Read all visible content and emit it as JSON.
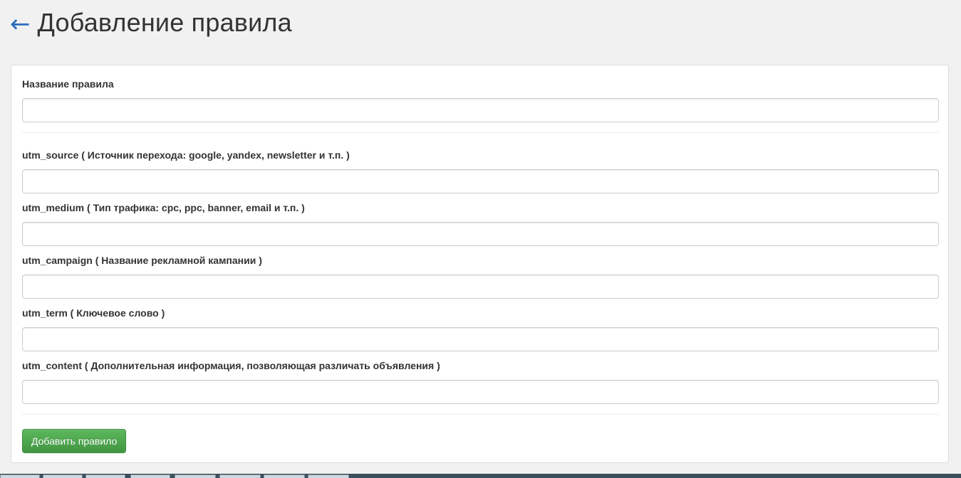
{
  "header": {
    "back_arrow": "←",
    "title": "Добавление правила"
  },
  "form": {
    "fields": [
      {
        "label": "Название правила",
        "value": "",
        "placeholder": ""
      },
      {
        "label": "utm_source ( Источник перехода: google, yandex, newsletter и т.п. )",
        "value": "",
        "placeholder": ""
      },
      {
        "label": "utm_medium ( Тип трафика: cpc, ppc, banner, email и т.п. )",
        "value": "",
        "placeholder": ""
      },
      {
        "label": "utm_campaign ( Название рекламной кампании )",
        "value": "",
        "placeholder": ""
      },
      {
        "label": "utm_term ( Ключевое слово )",
        "value": "",
        "placeholder": ""
      },
      {
        "label": "utm_content ( Дополнительная информация, позволяющая различать объявления )",
        "value": "",
        "placeholder": ""
      }
    ],
    "submit_label": "Добавить правило"
  },
  "colors": {
    "accent_link": "#2a6ebb",
    "button_green": "#5cb85c",
    "page_background": "#f1f1f1"
  }
}
